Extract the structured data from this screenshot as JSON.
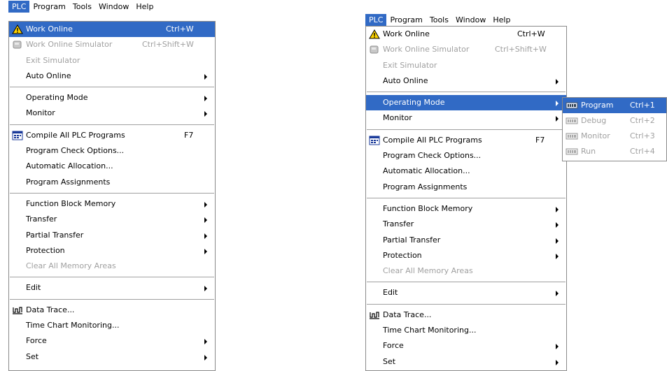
{
  "menubar": {
    "items": [
      "PLC",
      "Program",
      "Tools",
      "Window",
      "Help"
    ]
  },
  "plc_menu": {
    "work_online": {
      "label": "Work Online",
      "shortcut": "Ctrl+W"
    },
    "work_online_sim": {
      "label": "Work Online Simulator",
      "shortcut": "Ctrl+Shift+W"
    },
    "exit_sim": {
      "label": "Exit Simulator"
    },
    "auto_online": {
      "label": "Auto Online"
    },
    "operating_mode": {
      "label": "Operating Mode"
    },
    "monitor": {
      "label": "Monitor"
    },
    "compile_all": {
      "label": "Compile All PLC Programs",
      "shortcut": "F7"
    },
    "check_options": {
      "label": "Program Check Options..."
    },
    "auto_alloc": {
      "label": "Automatic Allocation..."
    },
    "prog_assign": {
      "label": "Program Assignments"
    },
    "fb_memory": {
      "label": "Function Block Memory"
    },
    "transfer": {
      "label": "Transfer"
    },
    "partial_transfer": {
      "label": "Partial Transfer"
    },
    "protection": {
      "label": "Protection"
    },
    "clear_memory": {
      "label": "Clear All Memory Areas"
    },
    "edit": {
      "label": "Edit"
    },
    "data_trace": {
      "label": "Data Trace..."
    },
    "time_chart": {
      "label": "Time Chart Monitoring..."
    },
    "force": {
      "label": "Force"
    },
    "set": {
      "label": "Set"
    }
  },
  "operating_mode_submenu": {
    "program": {
      "label": "Program",
      "shortcut": "Ctrl+1"
    },
    "debug": {
      "label": "Debug",
      "shortcut": "Ctrl+2"
    },
    "monitor": {
      "label": "Monitor",
      "shortcut": "Ctrl+3"
    },
    "run": {
      "label": "Run",
      "shortcut": "Ctrl+4"
    }
  },
  "colors": {
    "highlight": "#316ac5",
    "disabled": "#a0a0a0"
  }
}
